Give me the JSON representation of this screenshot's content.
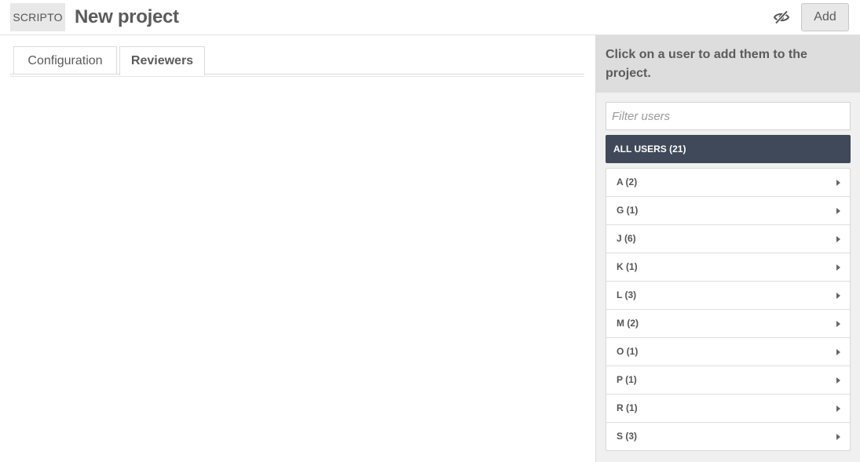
{
  "header": {
    "module_label": "SCRIPTO",
    "title": "New project",
    "visibility_icon": "eye-slash-icon",
    "add_label": "Add"
  },
  "tabs": [
    {
      "label": "Configuration",
      "active": false
    },
    {
      "label": "Reviewers",
      "active": true
    }
  ],
  "sidebar": {
    "instructions": "Click on a user to add them to the project.",
    "filter_placeholder": "Filter users",
    "all_users_label": "ALL USERS (21)",
    "groups": [
      {
        "label": "A (2)"
      },
      {
        "label": "G (1)"
      },
      {
        "label": "J (6)"
      },
      {
        "label": "K (1)"
      },
      {
        "label": "L (3)"
      },
      {
        "label": "M (2)"
      },
      {
        "label": "O (1)"
      },
      {
        "label": "P (1)"
      },
      {
        "label": "R (1)"
      },
      {
        "label": "S (3)"
      }
    ],
    "caret_icon": "caret-right-icon"
  },
  "colors": {
    "all_users_bg": "#404959",
    "sidebar_bg": "#f0f0f0",
    "instructions_bg": "#dddddd"
  }
}
